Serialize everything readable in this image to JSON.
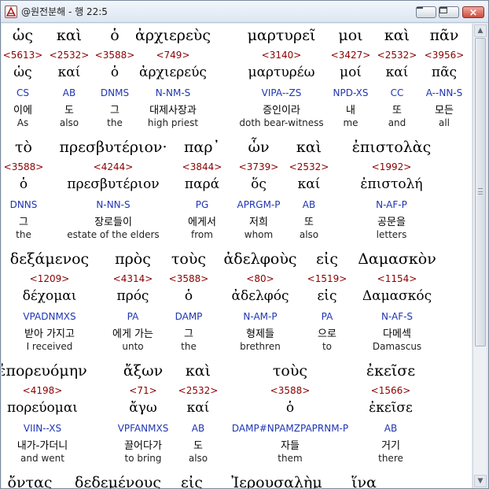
{
  "window": {
    "title": "@원전분해 - 행 22:5",
    "buttons": {
      "minimize": "minimize",
      "maximize": "maximize",
      "close": "×"
    }
  },
  "rows": [
    {
      "words": [
        {
          "greek": "ὡς",
          "strong": "<5613>",
          "lemma": "ὡς",
          "parse": "CS",
          "korean": "이에",
          "english": "As"
        },
        {
          "greek": "καὶ",
          "strong": "<2532>",
          "lemma": "καί",
          "parse": "AB",
          "korean": "도",
          "english": "also"
        },
        {
          "greek": "ὁ",
          "strong": "<3588>",
          "lemma": "ὁ",
          "parse": "DNMS",
          "korean": "그",
          "english": "the"
        },
        {
          "greek": "ἀρχιερεὺς",
          "strong": "<749>",
          "lemma": "ἀρχιερεύς",
          "parse": "N-NM-S",
          "korean": "대제사장과",
          "english": "high priest"
        },
        {
          "greek": "μαρτυρεῖ",
          "strong": "<3140>",
          "lemma": "μαρτυρέω",
          "parse": "VIPA--ZS",
          "korean": "증인이라",
          "english": "doth bear-witness"
        },
        {
          "greek": "μοι",
          "strong": "<3427>",
          "lemma": "μοί",
          "parse": "NPD-XS",
          "korean": "내",
          "english": "me"
        },
        {
          "greek": "καὶ",
          "strong": "<2532>",
          "lemma": "καί",
          "parse": "CC",
          "korean": "또",
          "english": "and"
        },
        {
          "greek": "πᾶν",
          "strong": "<3956>",
          "lemma": "πᾶς",
          "parse": "A--NN-S",
          "korean": "모든",
          "english": "all"
        }
      ]
    },
    {
      "words": [
        {
          "greek": "τὸ",
          "strong": "<3588>",
          "lemma": "ὁ",
          "parse": "DNNS",
          "korean": "그",
          "english": "the"
        },
        {
          "greek": "πρεσβυτέριον·",
          "strong": "<4244>",
          "lemma": "πρεσβυτέριον",
          "parse": "N-NN-S",
          "korean": "장로들이",
          "english": "estate of the elders"
        },
        {
          "greek": "παρ᾽",
          "strong": "<3844>",
          "lemma": "παρά",
          "parse": "PG",
          "korean": "에게서",
          "english": "from"
        },
        {
          "greek": "ὧν",
          "strong": "<3739>",
          "lemma": "ὅς",
          "parse": "APRGM-P",
          "korean": "저희",
          "english": "whom"
        },
        {
          "greek": "καὶ",
          "strong": "<2532>",
          "lemma": "καί",
          "parse": "AB",
          "korean": "또",
          "english": "also"
        },
        {
          "greek": "ἐπιστολὰς",
          "strong": "<1992>",
          "lemma": "ἐπιστολή",
          "parse": "N-AF-P",
          "korean": "공문을",
          "english": "letters"
        }
      ]
    },
    {
      "words": [
        {
          "greek": "δεξάμενος",
          "strong": "<1209>",
          "lemma": "δέχομαι",
          "parse": "VPADNMXS",
          "korean": "받아 가지고",
          "english": "I received"
        },
        {
          "greek": "πρὸς",
          "strong": "<4314>",
          "lemma": "πρός",
          "parse": "PA",
          "korean": "에게 가는",
          "english": "unto"
        },
        {
          "greek": "τοὺς",
          "strong": "<3588>",
          "lemma": "ὁ",
          "parse": "DAMP",
          "korean": "그",
          "english": "the"
        },
        {
          "greek": "ἀδελφοὺς",
          "strong": "<80>",
          "lemma": "ἀδελφός",
          "parse": "N-AM-P",
          "korean": "형제들",
          "english": "brethren"
        },
        {
          "greek": "εἰς",
          "strong": "<1519>",
          "lemma": "εἰς",
          "parse": "PA",
          "korean": "으로",
          "english": "to"
        },
        {
          "greek": "Δαμασκὸν",
          "strong": "<1154>",
          "lemma": "Δαμασκός",
          "parse": "N-AF-S",
          "korean": "다메섹",
          "english": "Damascus"
        }
      ]
    },
    {
      "words": [
        {
          "greek": "ἐπορευόμην",
          "strong": "<4198>",
          "lemma": "πορεύομαι",
          "parse": "VIIN--XS",
          "korean": "내가-가더니",
          "english": "and went"
        },
        {
          "greek": "ἄξων",
          "strong": "<71>",
          "lemma": "ἄγω",
          "parse": "VPFANMXS",
          "korean": "끌어다가",
          "english": "to bring"
        },
        {
          "greek": "καὶ",
          "strong": "<2532>",
          "lemma": "καί",
          "parse": "AB",
          "korean": "도",
          "english": "also"
        },
        {
          "greek": "τοὺς",
          "strong": "<3588>",
          "lemma": "ὁ",
          "parse": "DAMP#NPAMZPAPRNM-P",
          "korean": "자들",
          "english": "them"
        },
        {
          "greek": "ἐκεῖσε",
          "strong": "<1566>",
          "lemma": "ἐκεῖσε",
          "parse": "AB",
          "korean": "거기",
          "english": "there"
        }
      ]
    },
    {
      "words": [
        {
          "greek": "ὄντας"
        },
        {
          "greek": "δεδεμένους"
        },
        {
          "greek": "εἰς"
        },
        {
          "greek": "Ἰερουσαλὴμ"
        },
        {
          "greek": "ἵνα"
        }
      ]
    }
  ]
}
